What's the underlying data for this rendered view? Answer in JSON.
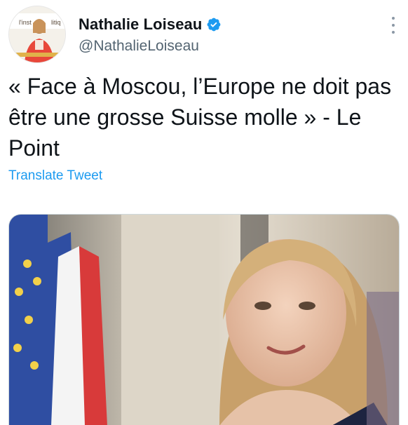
{
  "tweet": {
    "author": {
      "display_name": "Nathalie Loiseau",
      "handle": "@NathalieLoiseau",
      "verified": true,
      "avatar_label": "l'institut politique"
    },
    "text": "« Face à Moscou, l’Europe ne doit pas être une grosse Suisse molle » - Le Point",
    "translate_label": "Translate Tweet",
    "media": {
      "type": "photo",
      "description_icon": "photo-icon"
    }
  },
  "colors": {
    "accent": "#1d9bf0",
    "secondary_text": "#536471",
    "primary_text": "#0f1419",
    "verified": "#1d9bf0"
  },
  "icons": {
    "verified": "verified-badge-icon",
    "more": "more-options-icon"
  }
}
